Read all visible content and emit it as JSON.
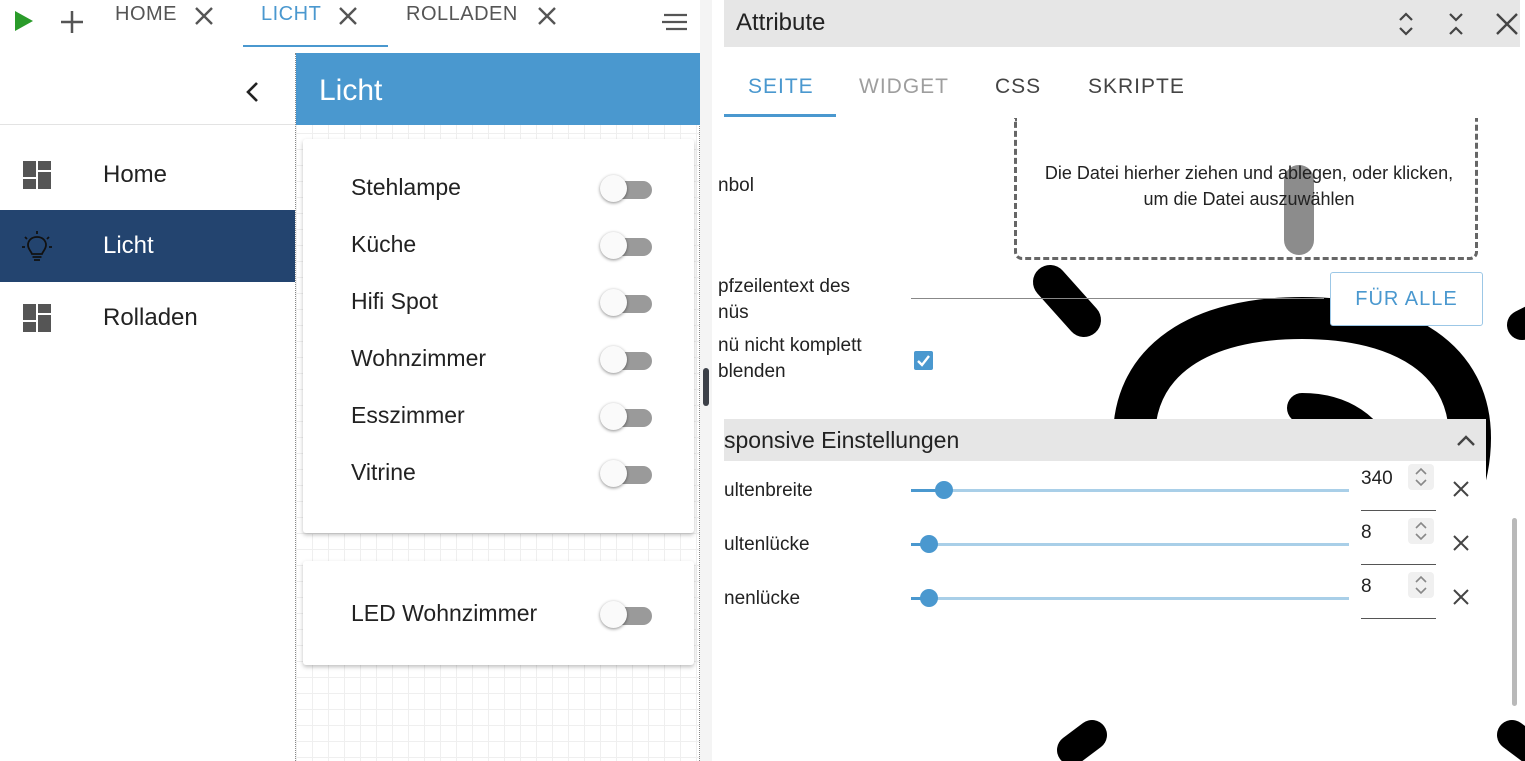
{
  "toolbar": {
    "play_icon": "play-icon",
    "add_icon": "plus-icon",
    "menu_icon": "sort-lines-icon"
  },
  "tabs": [
    {
      "label": "HOME",
      "active": false
    },
    {
      "label": "LICHT",
      "active": true
    },
    {
      "label": "ROLLADEN",
      "active": false
    }
  ],
  "sidebar": {
    "collapse_icon": "chevron-left-icon",
    "items": [
      {
        "label": "Home",
        "icon": "dashboard-icon",
        "active": false
      },
      {
        "label": "Licht",
        "icon": "lightbulb-icon",
        "active": true
      },
      {
        "label": "Rolladen",
        "icon": "dashboard-icon",
        "active": false
      }
    ]
  },
  "page": {
    "title": "Licht",
    "card1": {
      "switches": [
        {
          "label": "Stehlampe",
          "on": false
        },
        {
          "label": "Küche",
          "on": false
        },
        {
          "label": "Hifi Spot",
          "on": false
        },
        {
          "label": "Wohnzimmer",
          "on": false
        },
        {
          "label": "Esszimmer",
          "on": false
        },
        {
          "label": "Vitrine",
          "on": false
        }
      ]
    },
    "card2": {
      "switches": [
        {
          "label": "LED Wohnzimmer",
          "on": false
        }
      ]
    }
  },
  "attributes": {
    "title": "Attribute",
    "tabs": [
      {
        "label": "SEITE",
        "state": "active"
      },
      {
        "label": "WIDGET",
        "state": "disabled"
      },
      {
        "label": "CSS",
        "state": "normal"
      },
      {
        "label": "SKRIPTE",
        "state": "normal"
      }
    ],
    "symbol_label": "nbol",
    "dropzone_line1": "Die Datei hierher ziehen und ablegen, oder klicken,",
    "dropzone_line2": "um die Datei auszuwählen",
    "header_text_label_1": "pfzeilentext des",
    "header_text_label_2": "nüs",
    "apply_all_button": "FÜR ALLE",
    "hide_menu_label_1": "nü nicht komplett",
    "hide_menu_label_2": "blenden",
    "hide_menu_checked": true,
    "responsive": {
      "title": "sponsive Einstellungen",
      "rows": [
        {
          "label": "ultenbreite",
          "value": "340",
          "fraction": 0.075
        },
        {
          "label": "ultenlücke",
          "value": "8",
          "fraction": 0.04
        },
        {
          "label": "nenlücke",
          "value": "8",
          "fraction": 0.04
        }
      ]
    }
  },
  "colors": {
    "accent": "#4a98cf",
    "sidebar_active": "#23446f",
    "play_green": "#2a9b2a",
    "switch_off": "#9a9a9a"
  }
}
